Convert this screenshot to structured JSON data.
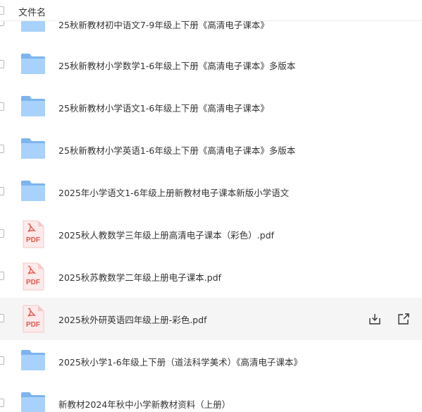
{
  "header": {
    "title": "文件名"
  },
  "files": [
    {
      "type": "folder",
      "name": "25秋新教材初中语文7-9年级上下册《高清电子课本》"
    },
    {
      "type": "folder",
      "name": "25秋新教材小学数学1-6年级上下册《高清电子课本》多版本"
    },
    {
      "type": "folder",
      "name": "25秋新教材小学语文1-6年级上下册《高清电子课本》"
    },
    {
      "type": "folder",
      "name": "25秋新教材小学英语1-6年级上下册《高清电子课本》多版本"
    },
    {
      "type": "folder",
      "name": "2025年小学语文1-6年级上册新教材电子课本新版小学语文"
    },
    {
      "type": "pdf",
      "name": "2025秋人教数学三年级上册高清电子课本（彩色）.pdf",
      "badge": "PDF"
    },
    {
      "type": "pdf",
      "name": "2025秋苏教数学二年级上册电子课本.pdf",
      "badge": "PDF"
    },
    {
      "type": "pdf",
      "name": "2025秋外研英语四年级上册-彩色.pdf",
      "badge": "PDF"
    },
    {
      "type": "folder",
      "name": "2025秋小学1-6年级上下册（道法科学美术）《高清电子课本》"
    },
    {
      "type": "folder",
      "name": "新教材2024年秋中小学新教材资料（上册）"
    }
  ],
  "icons": {
    "folder": "folder-icon",
    "pdf": "pdf-file-icon",
    "download": "download-icon",
    "share": "share-icon"
  },
  "colors": {
    "folder_back": "#7db4ee",
    "folder_front": "#a8d2fb",
    "pdf_red": "#e2574c",
    "pdf_paper": "#fdeaea",
    "hover_bg": "#f5f5f5"
  }
}
